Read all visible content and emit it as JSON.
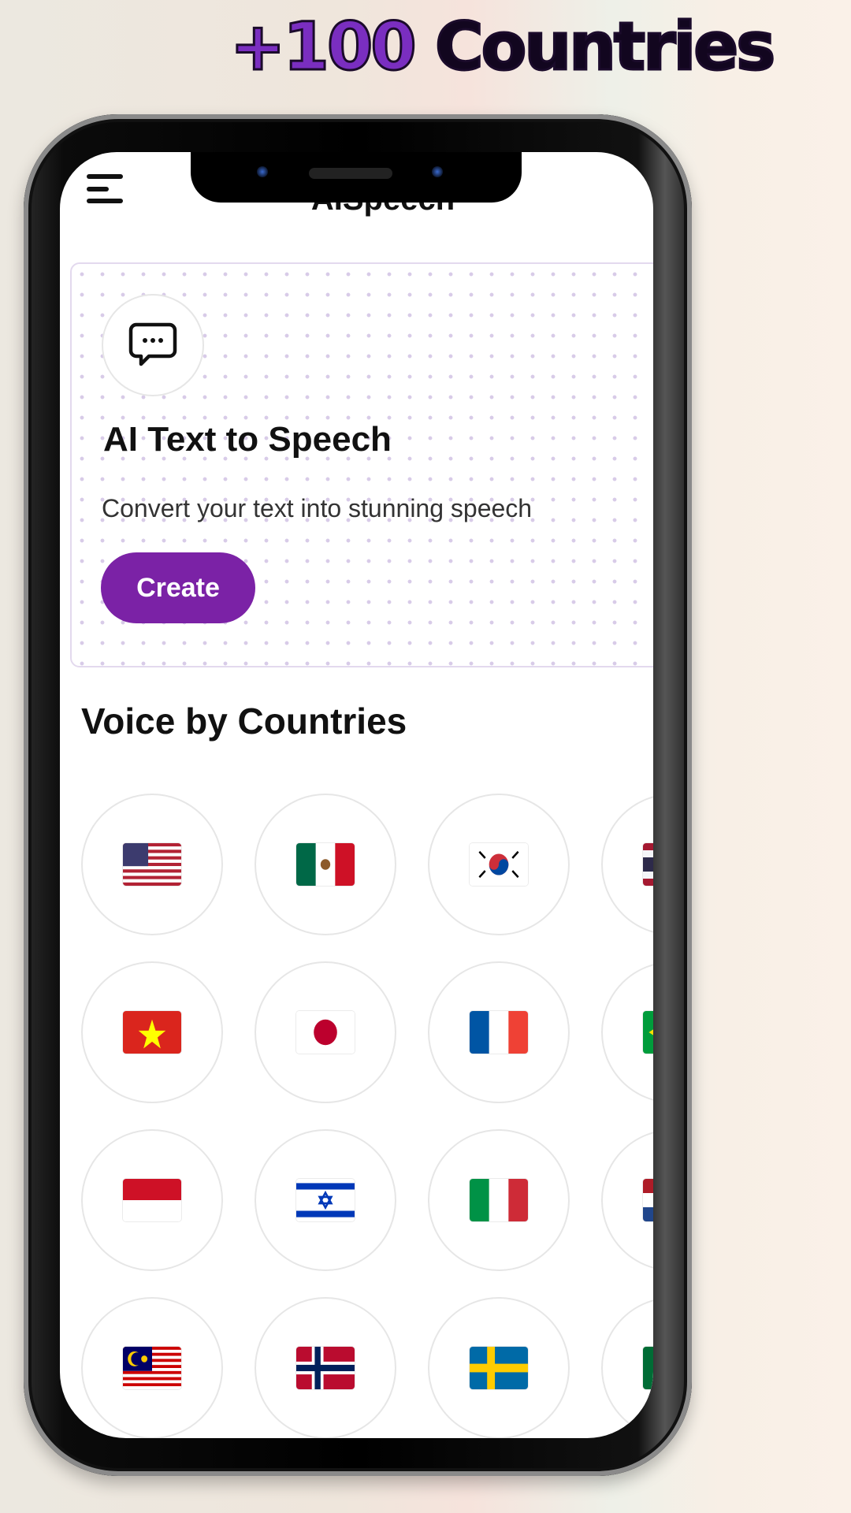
{
  "promo": {
    "accent": "+100",
    "rest": " Countries"
  },
  "app": {
    "title": "AISpeech",
    "menu_icon": "hamburger-menu-icon"
  },
  "card": {
    "icon": "chat-bubble-icon",
    "title": "AI Text to Speech",
    "subtitle": "Convert your text into stunning speech",
    "button_label": "Create"
  },
  "section_title": "Voice by Countries",
  "countries": [
    [
      "us",
      "mx",
      "kr",
      "th"
    ],
    [
      "vn",
      "jp",
      "fr",
      "br"
    ],
    [
      "id",
      "il",
      "it",
      "nl"
    ],
    [
      "my",
      "no",
      "se",
      "sa"
    ]
  ],
  "colors": {
    "accent": "#7b22a6",
    "promo_accent": "#7a2ec0"
  }
}
